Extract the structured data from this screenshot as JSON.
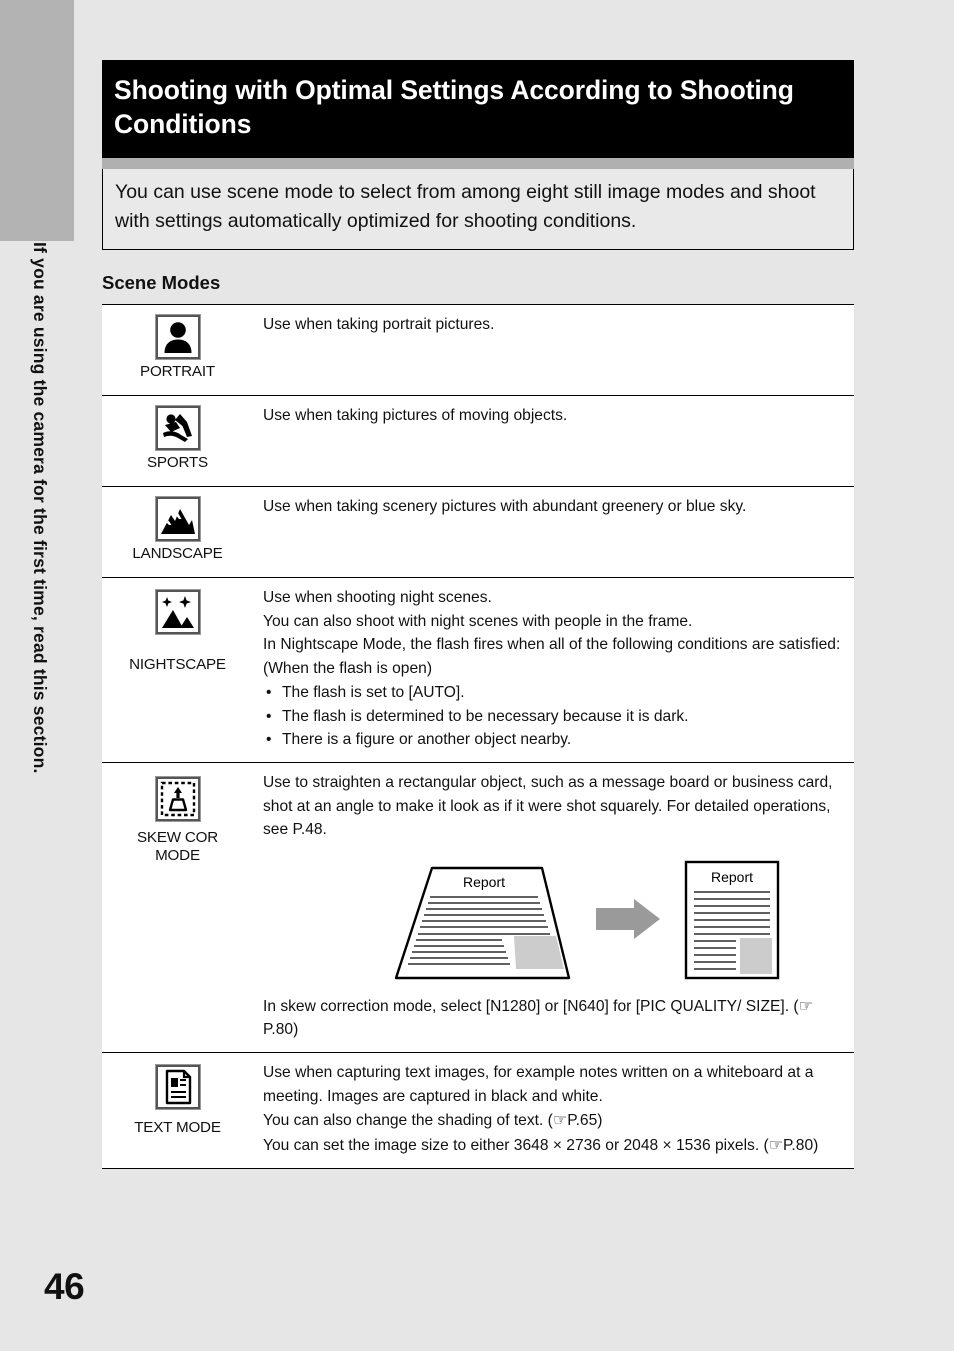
{
  "page": {
    "number": "46",
    "side_caption": "If you are using the camera for the first time, read this section.",
    "title": "Shooting with Optimal Settings According to Shooting Conditions",
    "intro": "You can use scene mode to select from among eight still image modes and shoot with settings automatically optimized for shooting conditions.",
    "section_heading": "Scene Modes",
    "colors": {
      "background": "#e6e6e6",
      "tab_gray": "#b3b3b3",
      "banner_black": "#000000",
      "banner_rule_gray": "#b0b0b0",
      "desc_box_gray": "#e9e9e9",
      "arrow_gray": "#9a9a9a",
      "swatch_gray": "#cccccc"
    }
  },
  "scene_modes": [
    {
      "icon": "portrait-icon",
      "label": "PORTRAIT",
      "description": "Use when taking portrait pictures."
    },
    {
      "icon": "sports-icon",
      "label": "SPORTS",
      "description": "Use when taking pictures of moving objects."
    },
    {
      "icon": "landscape-icon",
      "label": "LANDSCAPE",
      "description": "Use when taking scenery pictures with abundant greenery or blue sky."
    },
    {
      "icon": "nightscape-icon",
      "label": "NIGHTSCAPE",
      "lines": [
        "Use when shooting night scenes.",
        "You can also shoot with night scenes with people in the frame.",
        "In Nightscape Mode, the flash fires when all of the following conditions are satisfied: (When the flash is open)"
      ],
      "bullets": [
        "The flash is set to [AUTO].",
        "The flash is determined to be necessary because it is dark.",
        "There is a figure or another object nearby."
      ]
    },
    {
      "icon": "skew-correction-icon",
      "label_line1": "SKEW COR",
      "label_line2": "MODE",
      "intro": "Use to straighten a rectangular object, such as a message board or business card, shot at an angle to make it look as if it were shot squarely. For detailed operations, see P.48.",
      "figure": {
        "before_label": "Report",
        "after_label": "Report",
        "arrow": "right-arrow"
      },
      "outro_before_ref": "In skew correction mode, select [N1280] or [N640] for [PIC QUALITY/ SIZE]. (",
      "outro_ref": "P.80",
      "outro_after_ref": ")"
    },
    {
      "icon": "text-mode-icon",
      "label": "TEXT MODE",
      "lines": [
        "Use when capturing text images, for example notes written on a whiteboard at a meeting. Images are captured in black and white."
      ],
      "ref_line_1_before": "You can also change the shading of text. (",
      "ref_line_1_ref": "P.65",
      "ref_line_1_after": ")",
      "ref_line_2_before": "You can set the image size to either 3648 × 2736 or 2048 × 1536 pixels. (",
      "ref_line_2_ref": "P.80",
      "ref_line_2_after": ")"
    }
  ]
}
